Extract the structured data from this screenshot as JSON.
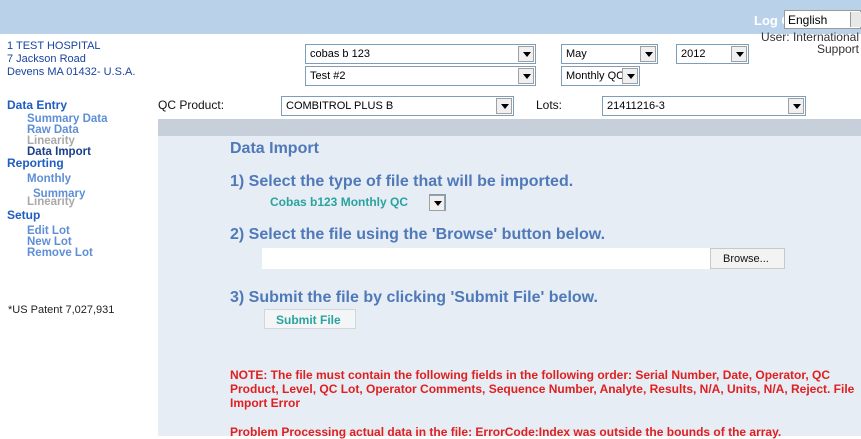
{
  "header": {
    "logout_label": "Log Out",
    "language": "English",
    "user_line1": "User: International",
    "user_line2": "Support"
  },
  "address": {
    "line1": "1 TEST HOSPITAL",
    "line2": "7 Jackson Road",
    "line3": "Devens MA 01432- U.S.A."
  },
  "filters": {
    "instrument": "cobas b 123",
    "test": "Test #2",
    "month": "May",
    "year": "2012",
    "period": "Monthly QC",
    "qc_product_label": "QC Product:",
    "qc_product": "COMBITROL PLUS B",
    "lots_label": "Lots:",
    "lot": "21411216-3"
  },
  "sidebar": {
    "data_entry": "Data Entry",
    "summary_data": "Summary Data",
    "raw_data": "Raw Data",
    "linearity": "Linearity",
    "data_import": "Data Import",
    "reporting": "Reporting",
    "monthly": "Monthly",
    "summary": "Summary",
    "linearity2": "Linearity",
    "setup": "Setup",
    "edit_lot": "Edit Lot",
    "new_lot": "New Lot",
    "remove_lot": "Remove Lot",
    "patent": "*US Patent 7,027,931"
  },
  "main": {
    "title": "Data Import",
    "step1": "1) Select the type of file that will be imported.",
    "file_type": "Cobas b123 Monthly QC",
    "step2": "2) Select the file using the 'Browse' button below.",
    "browse_label": "Browse...",
    "step3": "3) Submit the file by clicking 'Submit File' below.",
    "submit_label": "Submit File",
    "note": "NOTE: The file must contain the following fields in the following order: Serial Number, Date, Operator, QC Product, Level, QC Lot, Operator Comments, Sequence Number, Analyte, Results, N/A, Units, N/A, Reject. File Import Error",
    "error": "Problem Processing actual data in the file: ErrorCode:Index was outside the bounds of the array."
  },
  "colors": {
    "top_bar": "#b9d2ea",
    "nav_blue": "#1f5dbf",
    "heading_blue": "#4f79b8",
    "teal": "#2aa3a0",
    "error_red": "#e02020",
    "panel_bg": "#e6edf4"
  }
}
